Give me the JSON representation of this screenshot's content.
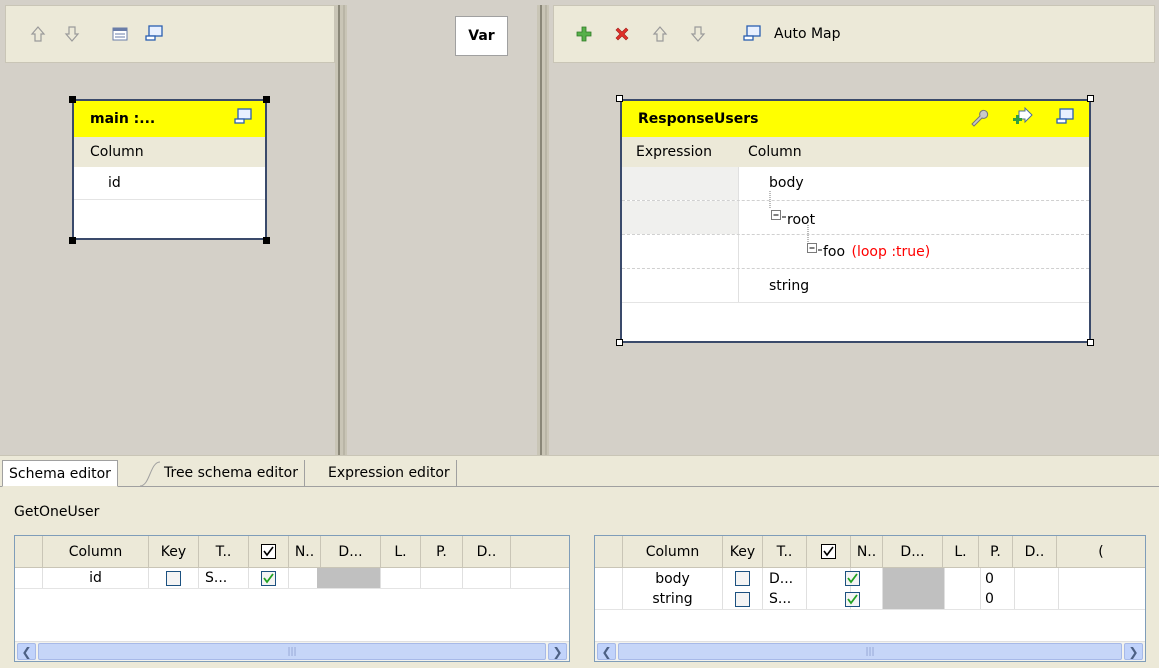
{
  "left_toolbar": {
    "icons": [
      "arrow-up-icon",
      "arrow-down-icon",
      "table-icon",
      "minimize-icon"
    ]
  },
  "var_panel": {
    "label": "Var"
  },
  "right_toolbar": {
    "icons": [
      "add-icon",
      "delete-icon",
      "arrow-up-icon",
      "arrow-down-icon",
      "minimize-icon"
    ],
    "auto_map_label": "Auto Map"
  },
  "input_table": {
    "title": "main :...",
    "column_header": "Column",
    "rows": [
      "id",
      ""
    ]
  },
  "output_table": {
    "title": "ResponseUsers",
    "expression_header": "Expression",
    "column_header": "Column",
    "tree": [
      {
        "label": "body",
        "level": 0
      },
      {
        "label": "root",
        "level": 1
      },
      {
        "label": "foo",
        "level": 2,
        "suffix": "(loop :true)"
      },
      {
        "label": "string",
        "level": 0
      }
    ]
  },
  "tabs": [
    "Schema editor",
    "Tree schema editor",
    "Expression editor"
  ],
  "schema_title": "GetOneUser",
  "left_schema": {
    "headers": [
      "Column",
      "Key",
      "T..",
      "",
      "N..",
      "D...",
      "L.",
      "P.",
      "D.."
    ],
    "rows": [
      {
        "column": "id",
        "key": false,
        "type": "S...",
        "nullable": true,
        "precision": ""
      }
    ]
  },
  "right_schema": {
    "headers": [
      "Column",
      "Key",
      "T..",
      "",
      "N..",
      "D...",
      "L.",
      "P.",
      "D..",
      "("
    ],
    "rows": [
      {
        "column": "body",
        "key": false,
        "type": "D...",
        "nullable": true,
        "precision": "0"
      },
      {
        "column": "string",
        "key": false,
        "type": "S...",
        "nullable": true,
        "precision": "0"
      }
    ]
  },
  "colors": {
    "header_yellow": "#ffff00",
    "loop_red": "#ff0000",
    "pane_gray": "#d4d0c8"
  }
}
